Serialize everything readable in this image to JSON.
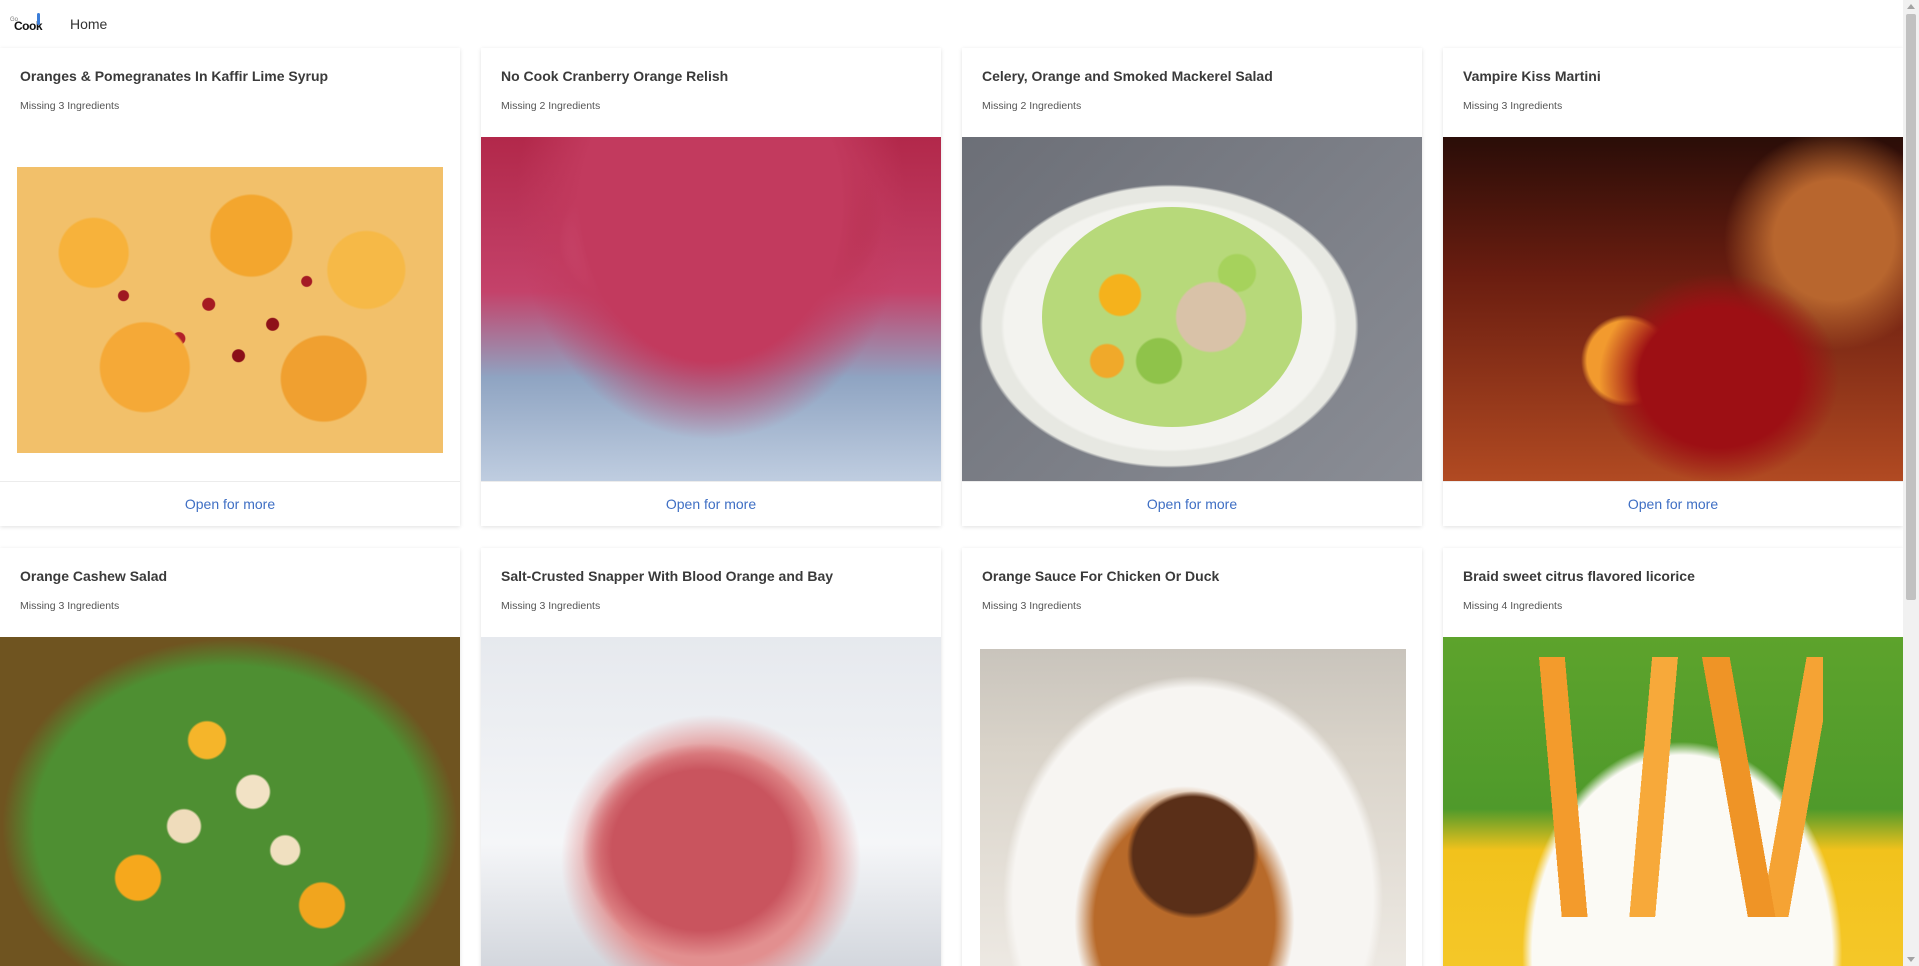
{
  "header": {
    "logo_text": "Cook",
    "logo_small": "Go",
    "home_label": "Home"
  },
  "recipes": [
    {
      "title": "Oranges & Pomegranates In Kaffir Lime Syrup",
      "missing": "Missing 3 Ingredients",
      "cta": "Open for more",
      "image": "oranges-pomegranates-photo"
    },
    {
      "title": "No Cook Cranberry Orange Relish",
      "missing": "Missing 2 Ingredients",
      "cta": "Open for more",
      "image": "cranberry-relish-photo"
    },
    {
      "title": "Celery, Orange and Smoked Mackerel Salad",
      "missing": "Missing 2 Ingredients",
      "cta": "Open for more",
      "image": "mackerel-salad-photo"
    },
    {
      "title": "Vampire Kiss Martini",
      "missing": "Missing 3 Ingredients",
      "cta": "Open for more",
      "image": "martini-photo"
    },
    {
      "title": "Orange Cashew Salad",
      "missing": "Missing 3 Ingredients",
      "image": "cashew-salad-photo"
    },
    {
      "title": "Salt-Crusted Snapper With Blood Orange and Bay",
      "missing": "Missing 3 Ingredients",
      "image": "snapper-photo"
    },
    {
      "title": "Orange Sauce For Chicken Or Duck",
      "missing": "Missing 3 Ingredients",
      "image": "duck-photo"
    },
    {
      "title": "Braid sweet citrus flavored licorice",
      "missing": "Missing 4 Ingredients",
      "image": "licorice-photo"
    }
  ],
  "colors": {
    "link": "#3f6fc4",
    "title": "#3a3a3a",
    "card_bg": "#ffffff"
  }
}
